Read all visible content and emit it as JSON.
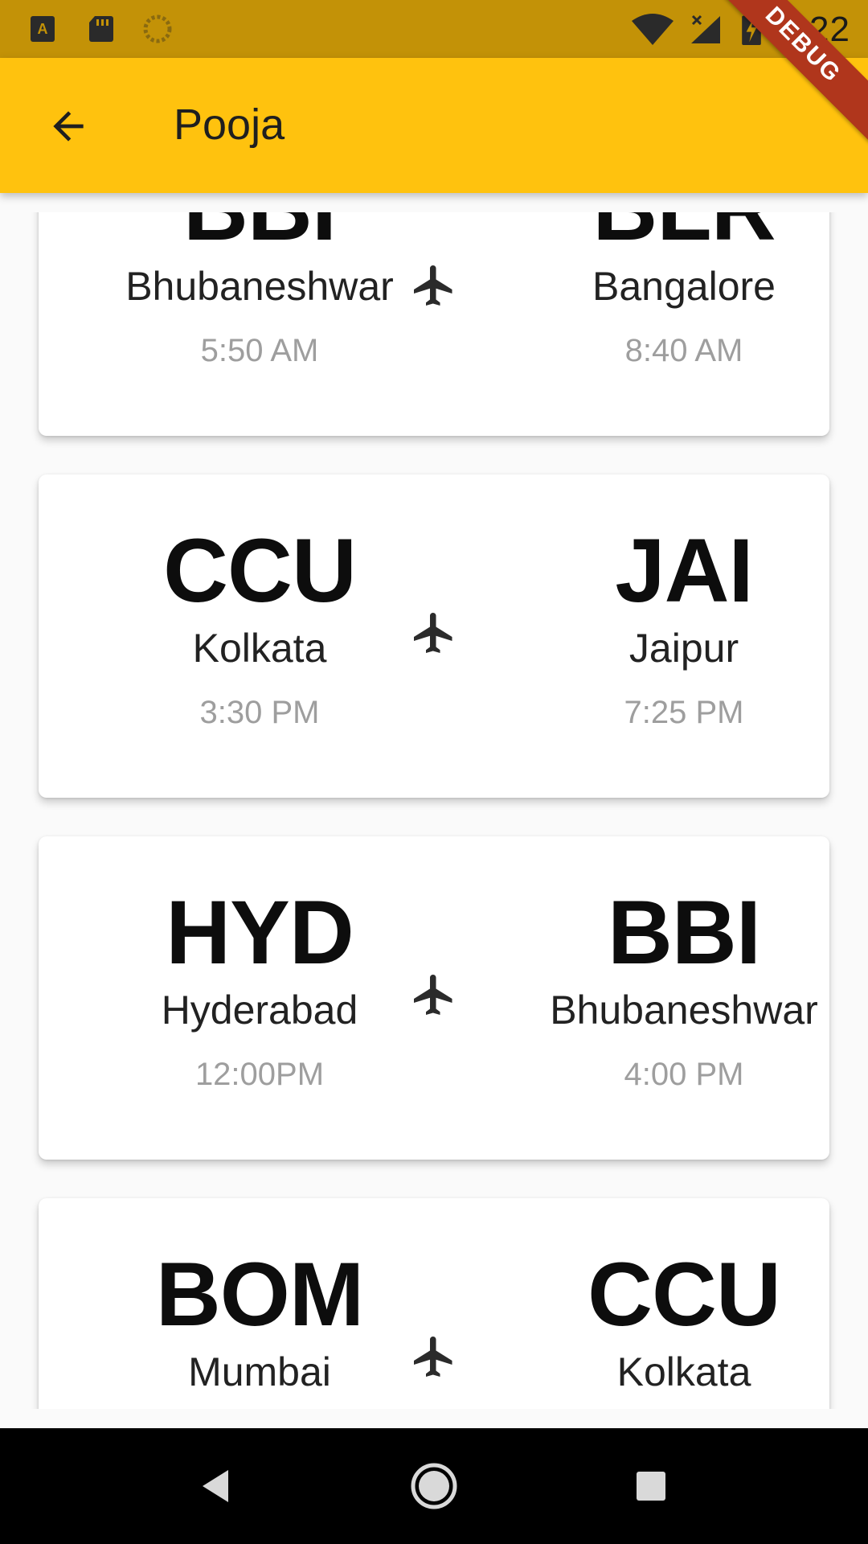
{
  "status_bar": {
    "time": "2:22",
    "left_icons": [
      "a-notification-icon",
      "sd-card-icon",
      "sync-icon"
    ],
    "right_icons": [
      "wifi-icon",
      "cell-signal-icon",
      "battery-charging-icon"
    ]
  },
  "app_bar": {
    "title": "Pooja",
    "back_icon": "arrow-back-icon"
  },
  "debug_banner": "DEBUG",
  "flights": [
    {
      "from": {
        "code": "BBI",
        "city": "Bhubaneshwar",
        "time": "5:50 AM"
      },
      "to": {
        "code": "BLR",
        "city": "Bangalore",
        "time": "8:40 AM"
      },
      "icon": "airplane-icon"
    },
    {
      "from": {
        "code": "CCU",
        "city": "Kolkata",
        "time": "3:30 PM"
      },
      "to": {
        "code": "JAI",
        "city": "Jaipur",
        "time": "7:25 PM"
      },
      "icon": "airplane-icon"
    },
    {
      "from": {
        "code": "HYD",
        "city": "Hyderabad",
        "time": "12:00PM"
      },
      "to": {
        "code": "BBI",
        "city": "Bhubaneshwar",
        "time": "4:00 PM"
      },
      "icon": "airplane-icon"
    },
    {
      "from": {
        "code": "BOM",
        "city": "Mumbai",
        "time": ""
      },
      "to": {
        "code": "CCU",
        "city": "Kolkata",
        "time": ""
      },
      "icon": "airplane-icon"
    }
  ],
  "colors": {
    "app_bar": "#ffc20e",
    "status_bar": "#c39207",
    "debug_banner": "#b0361c",
    "time_text": "#9e9e9e"
  },
  "nav_bar": {
    "buttons": [
      "back-triangle-icon",
      "home-circle-icon",
      "recents-square-icon"
    ]
  }
}
